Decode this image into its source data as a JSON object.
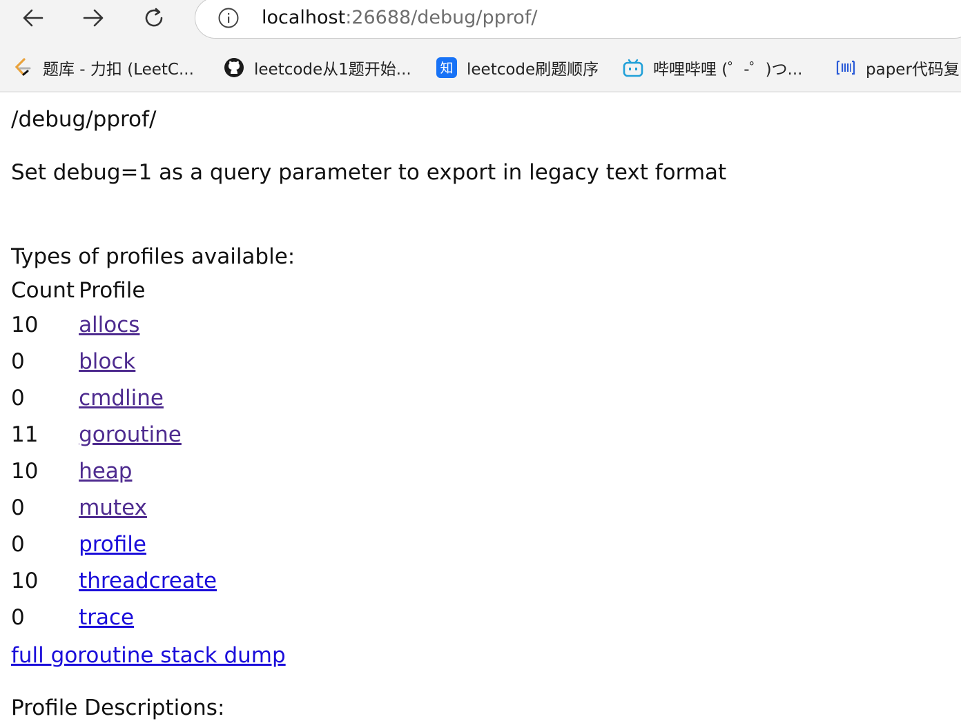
{
  "browser": {
    "url_host": "localhost",
    "url_rest": ":26688/debug/pprof/",
    "bookmarks": [
      {
        "label": "题库 - 力扣 (LeetC...",
        "icon": "leetcode-icon"
      },
      {
        "label": "leetcode从1题开始...",
        "icon": "github-icon"
      },
      {
        "label": "leetcode刷题顺序",
        "icon": "zhihu-icon"
      },
      {
        "label": "哔哩哔哩 (゜-゜)つ...",
        "icon": "bilibili-icon"
      },
      {
        "label": "paper代码复",
        "icon": "paperswithcode-icon"
      }
    ]
  },
  "page": {
    "title": "/debug/pprof/",
    "hint": "Set debug=1 as a query parameter to export in legacy text format",
    "types_heading": "Types of profiles available:",
    "table": {
      "headers": [
        "Count",
        "Profile"
      ],
      "rows": [
        {
          "count": "10",
          "profile": "allocs",
          "visited": true
        },
        {
          "count": "0",
          "profile": "block",
          "visited": true
        },
        {
          "count": "0",
          "profile": "cmdline",
          "visited": true
        },
        {
          "count": "11",
          "profile": "goroutine",
          "visited": true
        },
        {
          "count": "10",
          "profile": "heap",
          "visited": true
        },
        {
          "count": "0",
          "profile": "mutex",
          "visited": true
        },
        {
          "count": "0",
          "profile": "profile",
          "visited": false
        },
        {
          "count": "10",
          "profile": "threadcreate",
          "visited": false
        },
        {
          "count": "0",
          "profile": "trace",
          "visited": false
        }
      ]
    },
    "dump_link": "full goroutine stack dump",
    "descriptions_heading": "Profile Descriptions:"
  },
  "colors": {
    "link": "#1a0dda",
    "visited_link": "#4e2b8f",
    "chrome_bg": "#f3f3f3"
  }
}
